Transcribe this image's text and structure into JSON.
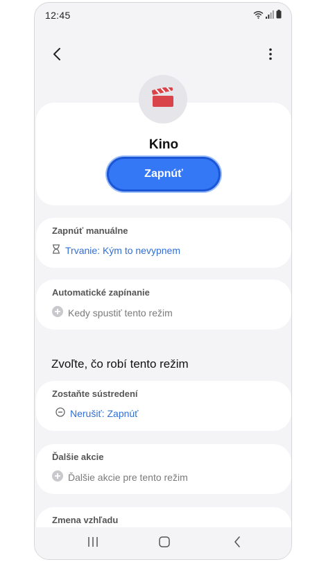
{
  "status_bar": {
    "time": "12:45",
    "icons": [
      "wifi-icon",
      "signal-icon",
      "battery-icon"
    ]
  },
  "top_bar": {
    "back_icon": "back-arrow-icon",
    "more_icon": "more-vertical-icon"
  },
  "mode": {
    "icon": "clapperboard-icon",
    "name": "Kino",
    "turn_on_label": "Zapnúť"
  },
  "manual": {
    "heading": "Zapnúť manuálne",
    "value": "Trvanie: Kým to nevypnem",
    "icon": "hourglass-icon"
  },
  "automatic": {
    "heading": "Automatické zapínanie",
    "value": "Kedy spustiť tento režim",
    "icon": "add-circle-icon"
  },
  "section_title": "Zvoľte, čo robí tento režim",
  "focus": {
    "heading": "Zostaňte sústredení",
    "value": "Nerušiť: Zapnúť",
    "icon": "do-not-disturb-icon"
  },
  "actions": {
    "heading": "Ďalšie akcie",
    "value": "Ďalšie akcie pre tento režim",
    "icon": "add-circle-icon"
  },
  "appearance": {
    "heading": "Zmena vzhľadu"
  },
  "nav_bar": {
    "icons": [
      "recent-apps-icon",
      "home-icon",
      "back-icon"
    ]
  },
  "colors": {
    "accent": "#3478f6",
    "link": "#2f6fd6",
    "clapper_red": "#d9434a",
    "background": "#f4f4f6"
  }
}
